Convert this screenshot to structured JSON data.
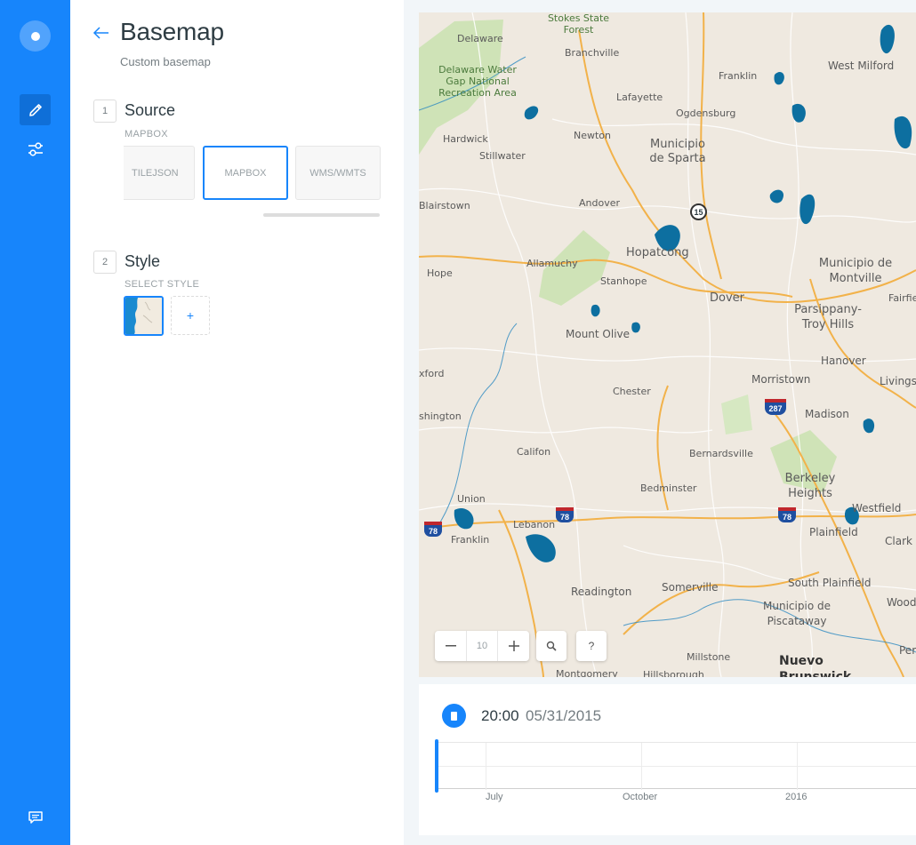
{
  "panel": {
    "title": "Basemap",
    "subtitle": "Custom basemap",
    "source": {
      "number": "1",
      "title": "Source",
      "label": "MAPBOX",
      "tabs": [
        "TILEJSON",
        "MAPBOX",
        "WMS/WMTS"
      ],
      "selected": "MAPBOX"
    },
    "style": {
      "number": "2",
      "title": "Style",
      "label": "SELECT STYLE",
      "add": "+"
    }
  },
  "map": {
    "zoom_out": "—",
    "zoom_level": "10",
    "zoom_in": "+",
    "help": "?",
    "labels": [
      "Stokes State Forest",
      "Delaware",
      "Branchville",
      "Franklin",
      "West Milford",
      "Delaware Water Gap National Recreation Area",
      "Lafayette",
      "Ogdensburg",
      "Hardwick",
      "Newton",
      "Municipio de Sparta",
      "Stillwater",
      "Blairstown",
      "Andover",
      "Hopatcong",
      "Municipio de Montville",
      "Allamuchy",
      "Hope",
      "Stanhope",
      "Dover",
      "Parsippany-Troy Hills",
      "Fairfie",
      "Mount Olive",
      "Hanover",
      "xford",
      "Morristown",
      "Livingst",
      "Chester",
      "Madison",
      "shington",
      "Califon",
      "Bernardsville",
      "Berkeley Heights",
      "Union",
      "Bedminster",
      "Westfield",
      "Lebanon",
      "Franklin",
      "Plainfield",
      "Clark",
      "Readington",
      "Somerville",
      "South Plainfield",
      "Wood",
      "Municipio de Piscataway",
      "Peri",
      "Millstone",
      "Nuevo Brunswick",
      "Montgomery",
      "Hillsborough"
    ],
    "shields": [
      "15",
      "287",
      "78",
      "78",
      "78"
    ],
    "colors": {
      "land": "#efe9e0",
      "water": "#0d6fa0",
      "park": "#cfe3b7",
      "road_major": "#f2b24a",
      "road_minor": "#ffffff"
    }
  },
  "timeline": {
    "time": "20:00",
    "date": "05/31/2015",
    "ticks": [
      "July",
      "October",
      "2016"
    ]
  },
  "colors": {
    "accent": "#1785fb"
  }
}
